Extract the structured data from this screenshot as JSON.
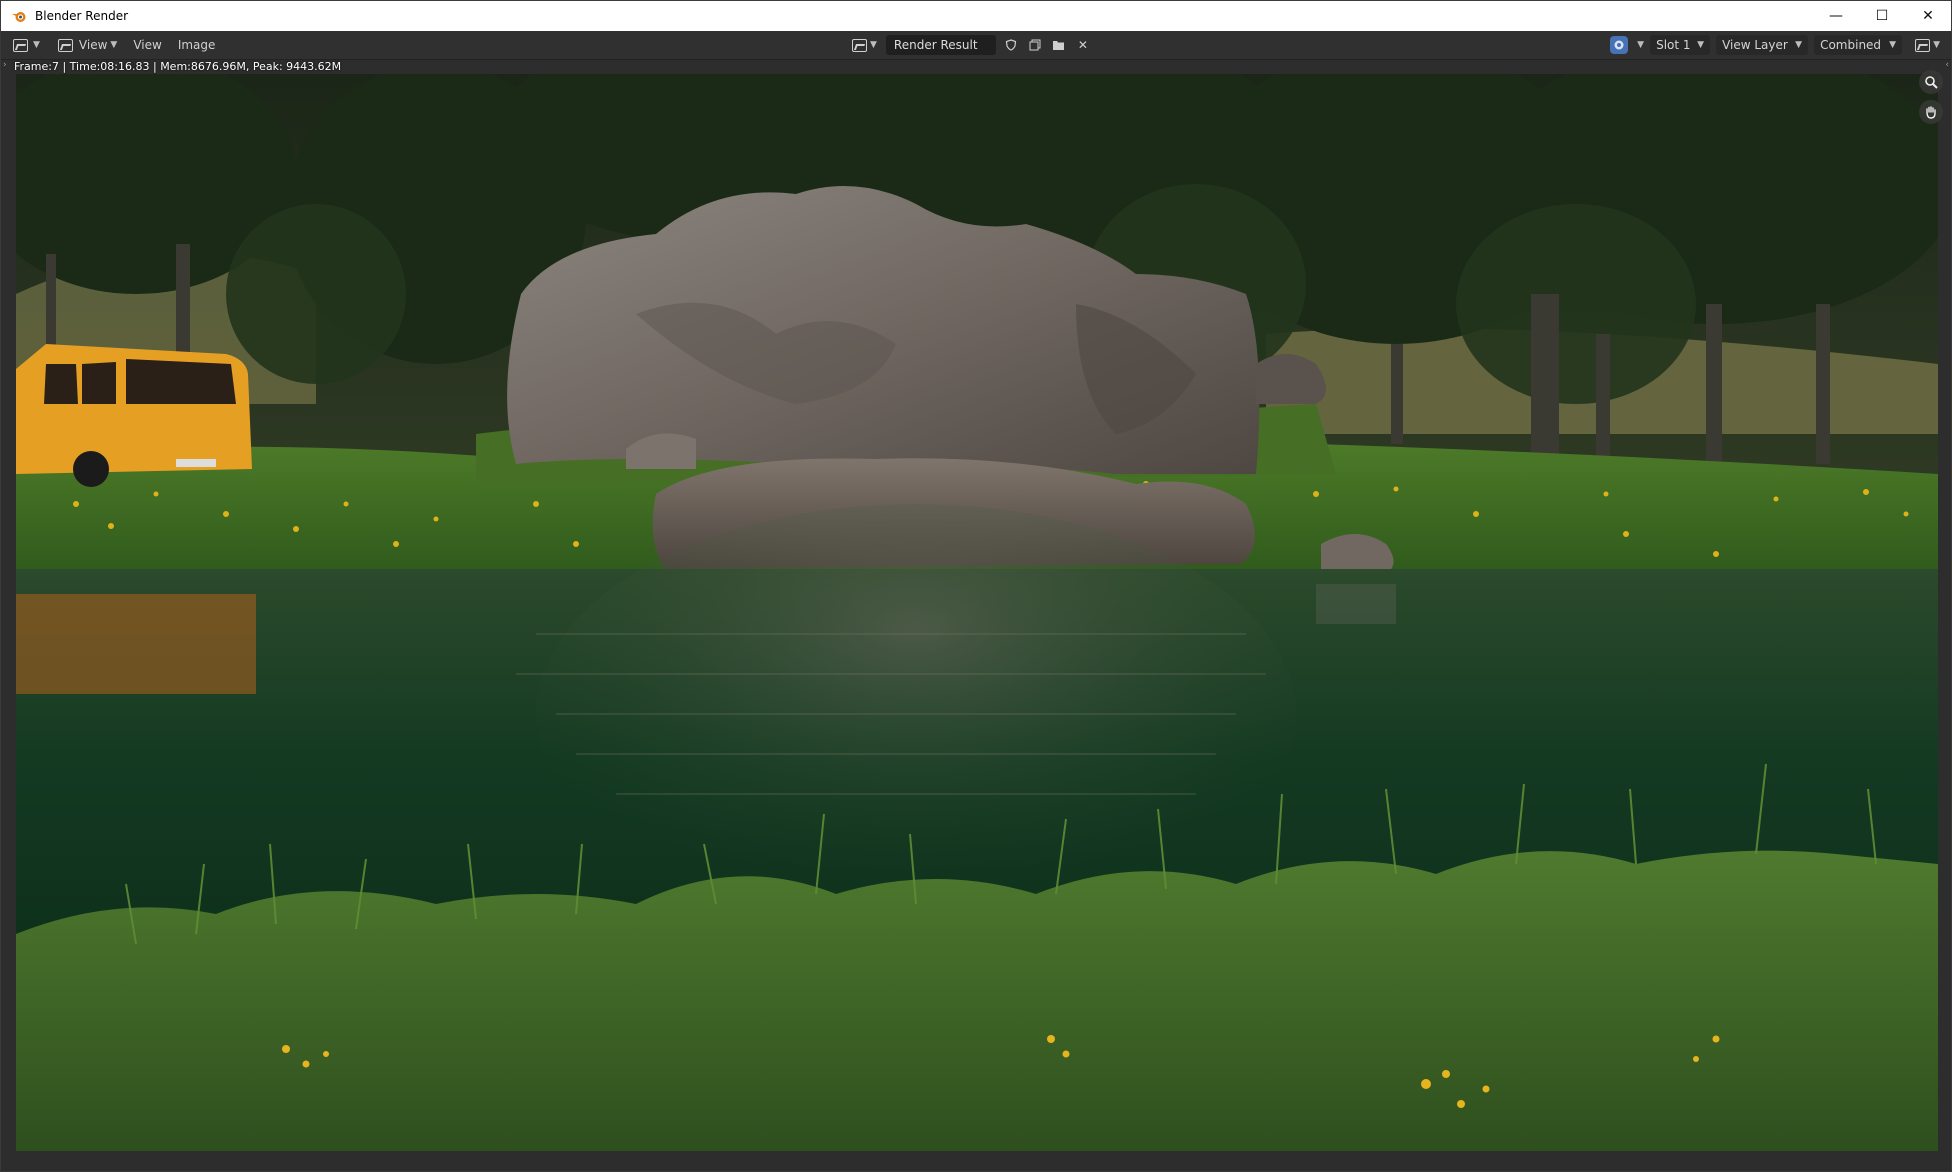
{
  "window": {
    "title": "Blender Render",
    "controls": {
      "minimize": "—",
      "maximize": "☐",
      "close": "✕"
    }
  },
  "header": {
    "menus": [
      "View",
      "View",
      "Image"
    ],
    "image_name": "Render Result",
    "slot": "Slot 1",
    "view_layer": "View Layer",
    "pass": "Combined"
  },
  "status": {
    "text": "Frame:7 | Time:08:16.83 | Mem:8676.96M, Peak: 9443.62M"
  },
  "colors": {
    "accent": "#4772b3",
    "header_bg": "#303030",
    "titlebar_bg": "#ffffff"
  },
  "icons": {
    "app": "blender-logo-icon",
    "zoom": "zoom-icon",
    "pan": "hand-icon"
  }
}
